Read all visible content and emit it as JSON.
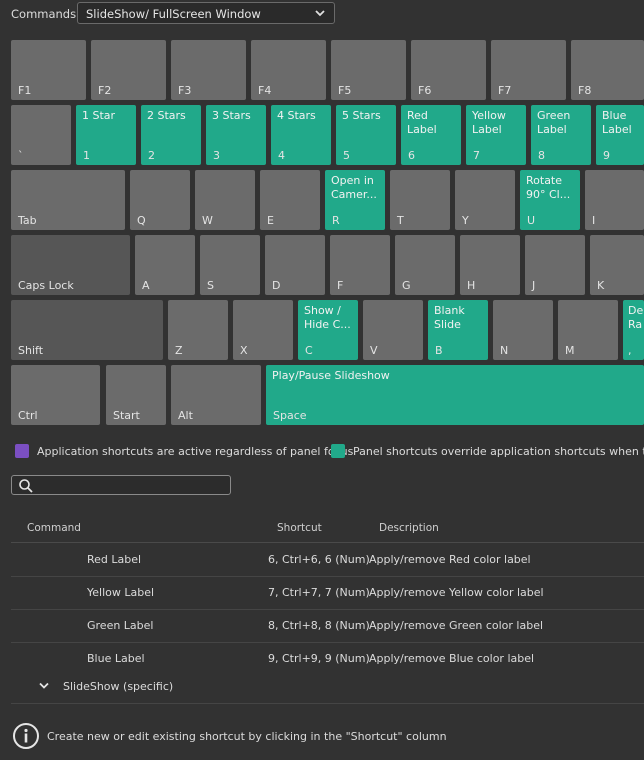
{
  "header": {
    "commands_label": "Commands:",
    "commands_value": "SlideShow/ FullScreen Window"
  },
  "keyboard": {
    "row1": {
      "f1": {
        "label": "F1"
      },
      "f2": {
        "label": "F2"
      },
      "f3": {
        "label": "F3"
      },
      "f4": {
        "label": "F4"
      },
      "f5": {
        "label": "F5"
      },
      "f6": {
        "label": "F6"
      },
      "f7": {
        "label": "F7"
      },
      "f8": {
        "label": "F8"
      }
    },
    "row2": {
      "backtick": {
        "label": "`"
      },
      "k1": {
        "label": "1",
        "command": "1 Star"
      },
      "k2": {
        "label": "2",
        "command": "2 Stars"
      },
      "k3": {
        "label": "3",
        "command": "3 Stars"
      },
      "k4": {
        "label": "4",
        "command": "4 Stars"
      },
      "k5": {
        "label": "5",
        "command": "5 Stars"
      },
      "k6": {
        "label": "6",
        "command": "Red\nLabel"
      },
      "k7": {
        "label": "7",
        "command": "Yellow\nLabel"
      },
      "k8": {
        "label": "8",
        "command": "Green\nLabel"
      },
      "k9": {
        "label": "9",
        "command": "Blue\nLabel"
      }
    },
    "row3": {
      "tab": {
        "label": "Tab"
      },
      "q": {
        "label": "Q"
      },
      "w": {
        "label": "W"
      },
      "e": {
        "label": "E"
      },
      "r": {
        "label": "R",
        "command": "Open in\nCamer..."
      },
      "t": {
        "label": "T"
      },
      "y": {
        "label": "Y"
      },
      "u": {
        "label": "U",
        "command": "Rotate\n90° Cl..."
      },
      "i": {
        "label": "I"
      }
    },
    "row4": {
      "capslock": {
        "label": "Caps Lock"
      },
      "a": {
        "label": "A"
      },
      "s": {
        "label": "S"
      },
      "d": {
        "label": "D"
      },
      "f": {
        "label": "F"
      },
      "g": {
        "label": "G"
      },
      "h": {
        "label": "H"
      },
      "j": {
        "label": "J"
      },
      "k": {
        "label": "K"
      }
    },
    "row5": {
      "shift": {
        "label": "Shift"
      },
      "z": {
        "label": "Z"
      },
      "x": {
        "label": "X"
      },
      "c": {
        "label": "C",
        "command": "Show /\nHide C..."
      },
      "v": {
        "label": "V"
      },
      "b": {
        "label": "B",
        "command": "Blank\nSlide"
      },
      "n": {
        "label": "N"
      },
      "m": {
        "label": "M"
      },
      "comma": {
        "label": ",",
        "command": "De\nRa"
      }
    },
    "row6": {
      "ctrl": {
        "label": "Ctrl"
      },
      "start": {
        "label": "Start"
      },
      "alt": {
        "label": "Alt"
      },
      "space": {
        "label": "Space",
        "command": "Play/Pause Slideshow"
      }
    }
  },
  "legend": {
    "app_text": "Application shortcuts are active regardless of panel focus",
    "app_color": "#7b4fc2",
    "panel_text": "Panel shortcuts override application shortcuts when the panel has focus",
    "panel_color": "#21a98a"
  },
  "search": {
    "placeholder": ""
  },
  "table": {
    "headers": {
      "command": "Command",
      "shortcut": "Shortcut",
      "description": "Description"
    },
    "rows": [
      {
        "command": "Red Label",
        "shortcut": "6, Ctrl+6, 6 (Num)",
        "description": "Apply/remove Red color label"
      },
      {
        "command": "Yellow Label",
        "shortcut": "7, Ctrl+7, 7 (Num)",
        "description": "Apply/remove Yellow color label"
      },
      {
        "command": "Green Label",
        "shortcut": "8, Ctrl+8, 8 (Num)",
        "description": "Apply/remove Green color label"
      },
      {
        "command": "Blue Label",
        "shortcut": "9, Ctrl+9, 9 (Num)",
        "description": "Apply/remove Blue color label"
      }
    ],
    "group": {
      "label": "SlideShow (specific)"
    }
  },
  "footer": {
    "hint": "Create new or edit existing shortcut by clicking in the \"Shortcut\" column"
  }
}
